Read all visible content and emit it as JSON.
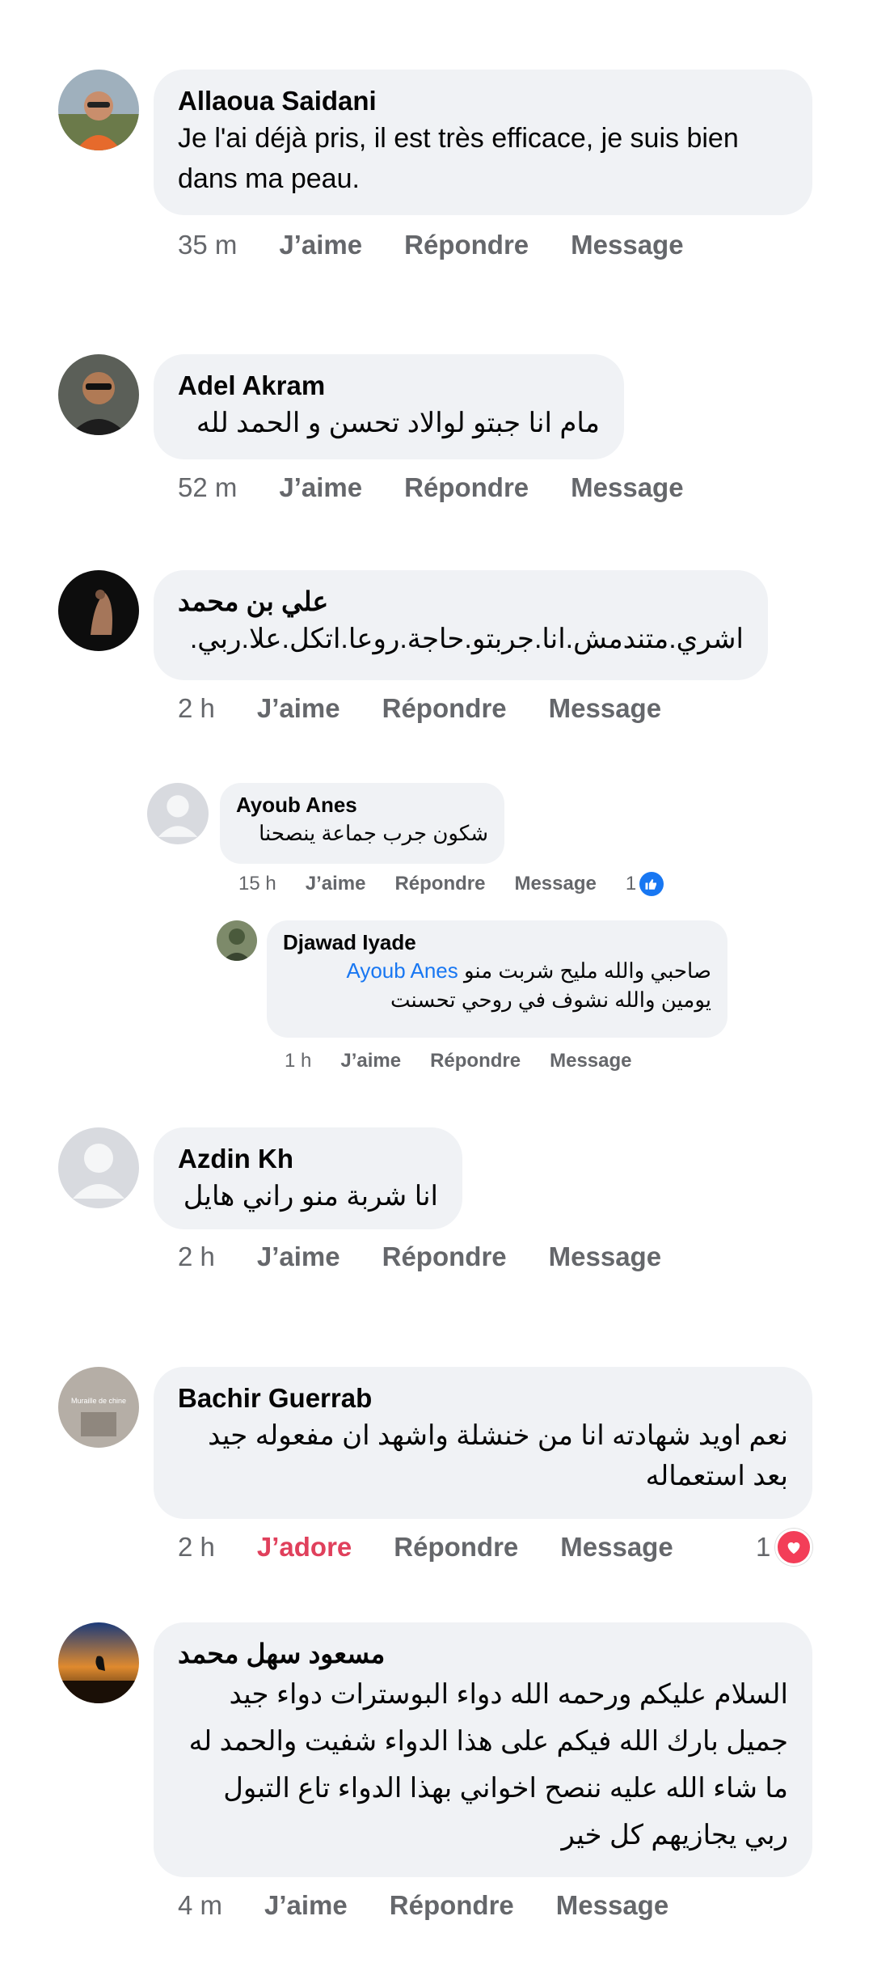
{
  "comments": [
    {
      "name": "Allaoua Saidani",
      "text": "Je l'ai déjà pris, il est très efficace, je suis bien dans ma peau.",
      "time": "35 m",
      "like": "J’aime",
      "reply": "Répondre",
      "message": "Message"
    },
    {
      "name": "Adel Akram",
      "text": "مام انا جبتو لوالاد تحسن و الحمد لله",
      "time": "52 m",
      "like": "J’aime",
      "reply": "Répondre",
      "message": "Message"
    },
    {
      "name": "علي بن محمد",
      "text": "اشري.متندمش.انا.جربتو.حاجة.روعا.اتكل.علا.ربي.",
      "time": "2 h",
      "like": "J’aime",
      "reply": "Répondre",
      "message": "Message"
    },
    {
      "name": "Azdin Kh",
      "text": "انا شربة منو راني هايل",
      "time": "2 h",
      "like": "J’aime",
      "reply": "Répondre",
      "message": "Message"
    },
    {
      "name": "Bachir Guerrab",
      "avatar_text": "Muraille de chine",
      "text": "نعم اويد شهادته انا من خنشلة واشهد ان مفعوله جيد بعد استعماله",
      "time": "2 h",
      "like": "J’adore",
      "reply": "Répondre",
      "message": "Message",
      "reaction_count": "1",
      "reaction_icon": "heart-icon",
      "reaction_color": "#f33e58"
    },
    {
      "name": "مسعود سهل محمد",
      "text": "السلام عليكم ورحمه الله دواء البوسترات دواء جيد جميل بارك الله فيكم على هذا الدواء شفيت والحمد له ما شاء الله عليه ننصح اخواني بهذا الدواء تاع التبول ربي يجازيهم كل خير",
      "time": "4 m",
      "like": "J’aime",
      "reply": "Répondre",
      "message": "Message"
    }
  ],
  "embedded_screenshot": {
    "first": {
      "name": "Ayoub Anes",
      "text": "شكون جرب جماعة ينصحنا",
      "time": "15 h",
      "like": "J’aime",
      "reply": "Répondre",
      "message": "Message",
      "reaction_count": "1",
      "reaction_icon": "like-icon"
    },
    "second": {
      "name": "Djawad Iyade",
      "mention": "Ayoub Anes",
      "text_line1": "صاحبي والله مليح شربت منو",
      "text_line2": "يومين والله نشوف في روحي تحسنت",
      "time": "1 h",
      "like": "J’aime",
      "reply": "Répondre",
      "message": "Message"
    }
  },
  "colors": {
    "bubble": "#f0f2f5",
    "meta": "#65676b",
    "adore": "#e0405c",
    "link": "#1877f2"
  }
}
